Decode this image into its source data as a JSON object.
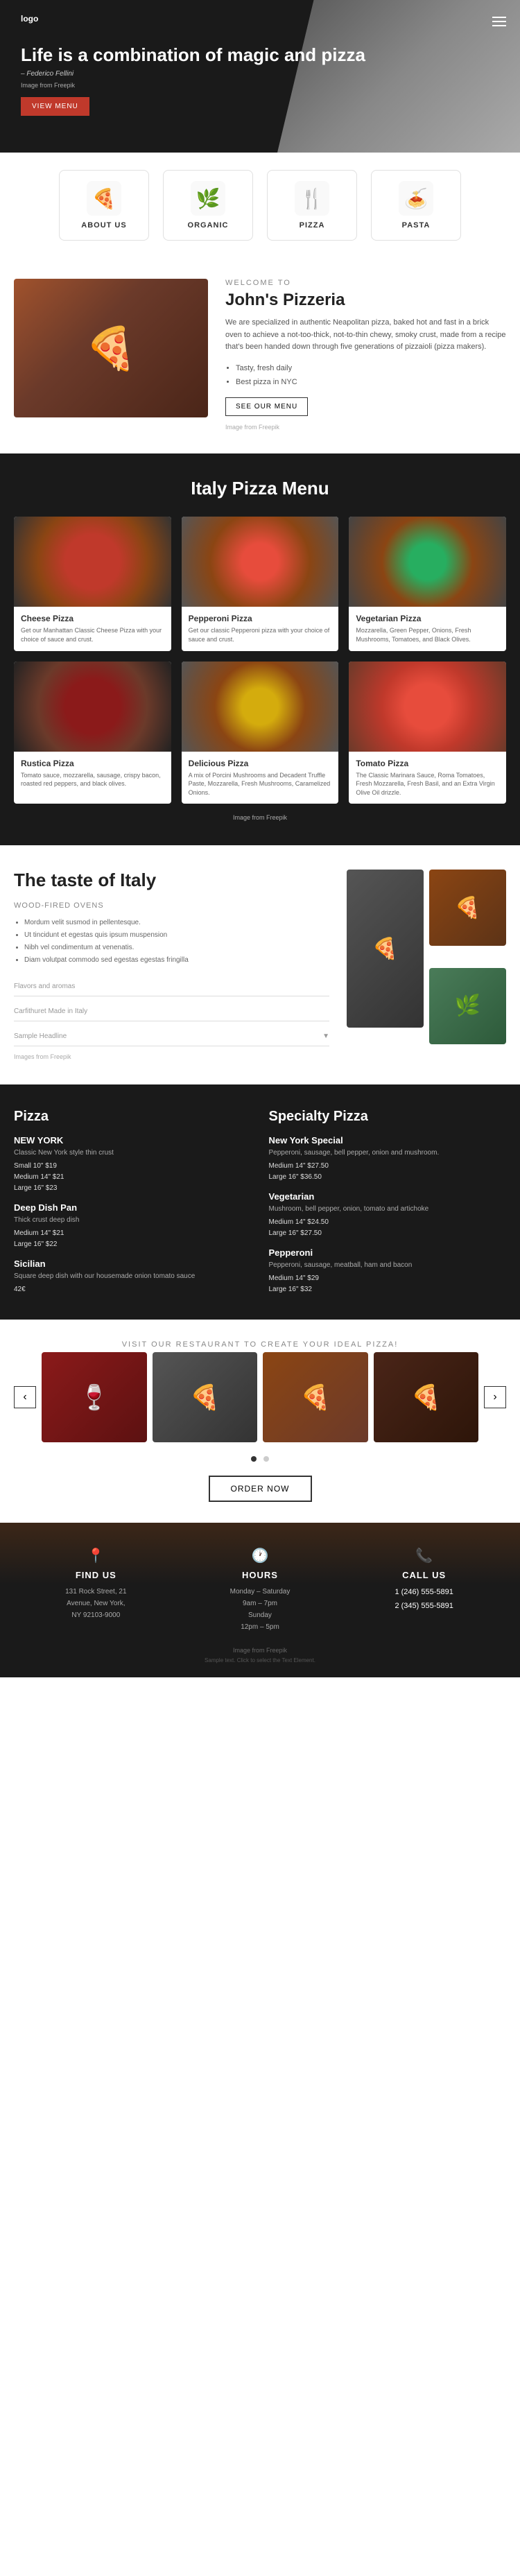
{
  "header": {
    "logo": "logo",
    "headline": "Life is a combination of magic and pizza",
    "author": "– Federico Fellini",
    "img_credit": "Image from Freepik",
    "btn_label": "VIEW MENU"
  },
  "categories": [
    {
      "id": "about-us",
      "icon": "🍕",
      "label": "ABOUT US"
    },
    {
      "id": "organic",
      "icon": "🌿",
      "label": "ORGANIC"
    },
    {
      "id": "pizza",
      "icon": "🍴",
      "label": "PIZZA"
    },
    {
      "id": "pasta",
      "icon": "🍝",
      "label": "PASTA"
    }
  ],
  "welcome": {
    "subtitle": "WELCOME TO",
    "title": "John's Pizzeria",
    "description": "We are specialized in authentic Neapolitan pizza, baked hot and fast in a brick oven to achieve a not-too-thick, not-to-thin chewy, smoky crust, made from a recipe that's been handed down through five generations of pizzaioli (pizza makers).",
    "bullets": [
      "Tasty, fresh daily",
      "Best pizza in NYC"
    ],
    "btn_label": "SEE OUR MENU",
    "img_credit": "Image from Freepik"
  },
  "pizza_menu": {
    "title": "Italy Pizza Menu",
    "img_credit": "Image from Freepik",
    "items": [
      {
        "id": "cheese-pizza",
        "title": "Cheese Pizza",
        "description": "Get our Manhattan Classic Cheese Pizza with your choice of sauce and crust."
      },
      {
        "id": "pepperoni-pizza",
        "title": "Pepperoni Pizza",
        "description": "Get our classic Pepperoni pizza with your choice of sauce and crust."
      },
      {
        "id": "vegetarian-pizza",
        "title": "Vegetarian Pizza",
        "description": "Mozzarella, Green Pepper, Onions, Fresh Mushrooms, Tomatoes, and Black Olives."
      },
      {
        "id": "rustica-pizza",
        "title": "Rustica Pizza",
        "description": "Tomato sauce, mozzarella, sausage, crispy bacon, roasted red peppers, and black olives."
      },
      {
        "id": "delicious-pizza",
        "title": "Delicious Pizza",
        "description": "A mix of Porcini Mushrooms and Decadent Truffle Paste, Mozzarella, Fresh Mushrooms, Caramelized Onions."
      },
      {
        "id": "tomato-pizza",
        "title": "Tomato Pizza",
        "description": "The Classic Marinara Sauce, Roma Tomatoes, Fresh Mozzarella, Fresh Basil, and an Extra Virgin Olive Oil drizzle."
      }
    ]
  },
  "taste": {
    "title": "The taste of Italy",
    "subheading": "Wood-fired ovens",
    "bullets": [
      "Mordum velit susmod in pellentesque.",
      "Ut tincidunt et egestas quis ipsum muspension",
      "Nibh vel condimentum at venenatis.",
      "Diam volutpat commodo sed egestas egestas fringilla"
    ],
    "field1": "Flavors and aromas",
    "field2": "Carfithuret Made in Italy",
    "dropdown": "Sample Headline",
    "img_credit": "Images from Freepik"
  },
  "menu_dark": {
    "pizza_title": "Pizza",
    "specialty_title": "Specialty Pizza",
    "pizza_items": [
      {
        "name": "NEW YORK",
        "description": "Classic New York style thin crust",
        "prices": "Small 10\" $19\nMedium 14\" $21\nLarge 16\" $23"
      },
      {
        "name": "Deep Dish Pan",
        "description": "Thick crust deep dish",
        "prices": "Medium 14\" $21\nLarge 16\" $22"
      },
      {
        "name": "Sicilian",
        "description": "Square deep dish with our housemade onion tomato sauce",
        "prices": "42€"
      }
    ],
    "specialty_items": [
      {
        "name": "New York Special",
        "description": "Pepperoni, sausage, bell pepper, onion and mushroom.",
        "prices": "Medium 14\" $27.50\nLarge 16\" $36.50"
      },
      {
        "name": "Vegetarian",
        "description": "Mushroom, bell pepper, onion, tomato and artichoke",
        "prices": "Medium 14\" $24.50\nLarge 16\" $27.50"
      },
      {
        "name": "Pepperoni",
        "description": "Pepperoni, sausage, meatball, ham and bacon",
        "prices": "Medium 14\" $29\nLarge 16\" $32"
      }
    ]
  },
  "gallery": {
    "subtitle": "Visit our restaurant to create your ideal pizza!",
    "title": "",
    "btn_label": "ORDER NOW",
    "dots": [
      true,
      false
    ]
  },
  "footer": {
    "columns": [
      {
        "id": "find-us",
        "icon": "📍",
        "title": "FIND US",
        "text": "131 Rock Street, 21\nAvenue, New York,\nNY 92103-9000"
      },
      {
        "id": "hours",
        "icon": "🕐",
        "title": "HOURS",
        "text": "Monday - Saturday\n9am – 7pm\nSunday\n12pm – 5pm"
      },
      {
        "id": "call-us",
        "icon": "📞",
        "title": "CALL US",
        "phones": [
          "1 (246) 555-5891",
          "2 (345) 555-5891"
        ]
      }
    ],
    "img_credit": "Image from Freepik",
    "note": "Sample text. Click to select the Text Element."
  }
}
